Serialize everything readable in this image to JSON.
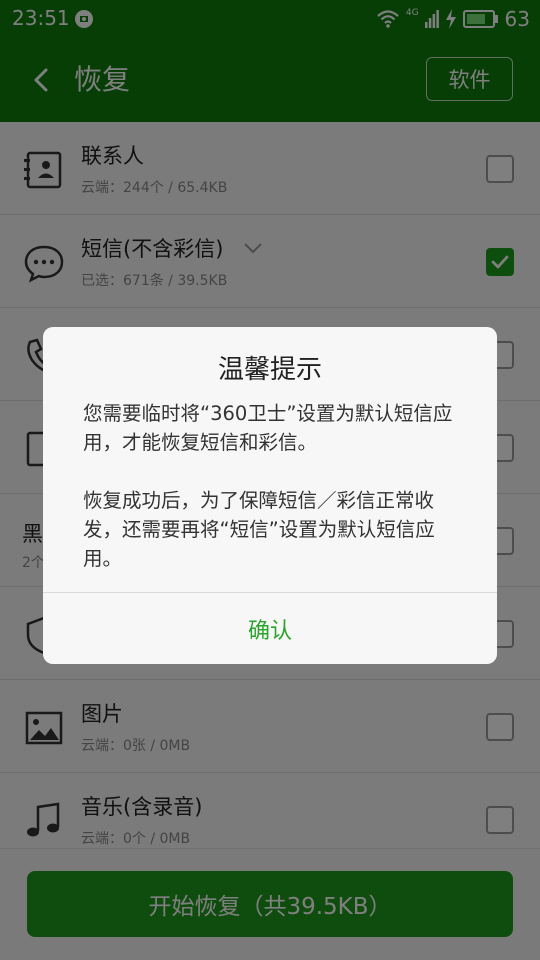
{
  "status_bar": {
    "time": "23:51",
    "battery_percent": "63",
    "network_label": "4G"
  },
  "header": {
    "title": "恢复",
    "software_button": "软件",
    "background_color": "#0c7d0c"
  },
  "list": {
    "items": [
      {
        "title": "联系人",
        "subtitle": "云端：244个 / 65.4KB",
        "checked": false,
        "icon": "contacts-icon"
      },
      {
        "title": "短信(不含彩信)",
        "subtitle": "已选：671条 / 39.5KB",
        "checked": true,
        "icon": "message-icon"
      },
      {
        "title": "",
        "subtitle": "",
        "checked": false,
        "icon": "phone-icon"
      },
      {
        "title": "",
        "subtitle": "",
        "checked": false,
        "icon": "tablet-icon"
      },
      {
        "title": "黑",
        "subtitle": "2个",
        "checked": false,
        "icon": ""
      },
      {
        "title": "",
        "subtitle": "",
        "checked": false,
        "icon": "shield-icon"
      },
      {
        "title": "图片",
        "subtitle": "云端：0张 / 0MB",
        "checked": false,
        "icon": "image-icon"
      },
      {
        "title": "音乐(含录音)",
        "subtitle": "云端：0个 / 0MB",
        "checked": false,
        "icon": "music-icon"
      }
    ]
  },
  "bottom": {
    "start_button": "开始恢复（共39.5KB）"
  },
  "dialog": {
    "title": "温馨提示",
    "paragraph1": "您需要临时将“360卫士”设置为默认短信应用，才能恢复短信和彩信。",
    "paragraph2": "恢复成功后，为了保障短信／彩信正常收发，还需要再将“短信”设置为默认短信应用。",
    "confirm_button": "确认",
    "confirm_color": "#2aa52a"
  }
}
